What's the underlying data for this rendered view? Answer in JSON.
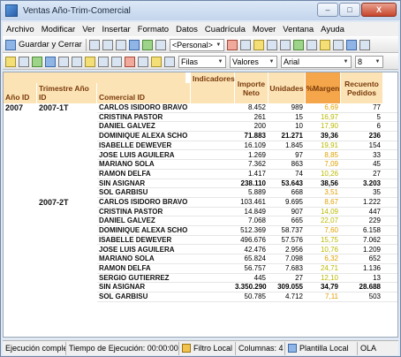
{
  "window": {
    "title": "Ventas Año-Trim-Comercial",
    "controls": [
      "–",
      "□",
      "X"
    ]
  },
  "menu": [
    "Archivo",
    "Modificar",
    "Ver",
    "Insertar",
    "Formato",
    "Datos",
    "Cuadrícula",
    "Mover",
    "Ventana",
    "Ayuda"
  ],
  "toolbar1": {
    "save_close_label": "Guardar y Cerrar",
    "style_select": "<Personal>"
  },
  "toolbar2": {
    "rows_select": "Filas",
    "values_select": "Valores",
    "font_select": "Arial",
    "size_select": "8"
  },
  "grid": {
    "headers": {
      "year": "Año ID",
      "quarter": "Trimestre Año ID",
      "comercial": "Comercial ID",
      "indicadores": "Indicadores",
      "importe": "Importe Neto",
      "unidades": "Unidades",
      "margen": "%Margen",
      "recuento": "Recuento Pedidos"
    },
    "colors": {
      "header_bg": "#fbe3b6",
      "margen_header_bg": "#f5a64a",
      "margen_good": "#b9b900",
      "margen_bad": "#e0a000"
    },
    "year": "2007",
    "groups": [
      {
        "quarter": "2007-1T",
        "rows": [
          {
            "name": "CARLOS ISIDORO BRAVO",
            "importe": "8.452",
            "unidades": "989",
            "margen": "6,69",
            "recuento": "77",
            "bold": false
          },
          {
            "name": "CRISTINA PASTOR",
            "importe": "261",
            "unidades": "15",
            "margen": "16,97",
            "recuento": "5",
            "bold": false
          },
          {
            "name": "DANIEL GALVEZ",
            "importe": "200",
            "unidades": "10",
            "margen": "17,90",
            "recuento": "6",
            "bold": false
          },
          {
            "name": "DOMINIQUE ALEXA SCHO",
            "importe": "71.883",
            "unidades": "21.271",
            "margen": "39,36",
            "recuento": "236",
            "bold": true
          },
          {
            "name": "ISABELLE DEWEVER",
            "importe": "16.109",
            "unidades": "1.845",
            "margen": "19,91",
            "recuento": "154",
            "bold": false
          },
          {
            "name": "JOSE LUIS AGUILERA",
            "importe": "1.269",
            "unidades": "97",
            "margen": "8,85",
            "recuento": "33",
            "bold": false
          },
          {
            "name": "MARIANO SOLA",
            "importe": "7.362",
            "unidades": "863",
            "margen": "7,09",
            "recuento": "45",
            "bold": false
          },
          {
            "name": "RAMON DELFA",
            "importe": "1.417",
            "unidades": "74",
            "margen": "10,26",
            "recuento": "27",
            "bold": false
          },
          {
            "name": "SIN ASIGNAR",
            "importe": "238.110",
            "unidades": "53.643",
            "margen": "38,56",
            "recuento": "3.203",
            "bold": true
          },
          {
            "name": "SOL GARBISU",
            "importe": "5.889",
            "unidades": "668",
            "margen": "3,51",
            "recuento": "35",
            "bold": false
          }
        ]
      },
      {
        "quarter": "2007-2T",
        "rows": [
          {
            "name": "CARLOS ISIDORO BRAVO",
            "importe": "103.461",
            "unidades": "9.695",
            "margen": "8,67",
            "recuento": "1.222",
            "bold": false
          },
          {
            "name": "CRISTINA PASTOR",
            "importe": "14.849",
            "unidades": "907",
            "margen": "14,09",
            "recuento": "447",
            "bold": false
          },
          {
            "name": "DANIEL GALVEZ",
            "importe": "7.068",
            "unidades": "665",
            "margen": "22,07",
            "recuento": "229",
            "bold": false
          },
          {
            "name": "DOMINIQUE ALEXA SCHO",
            "importe": "512.369",
            "unidades": "58.737",
            "margen": "7,60",
            "recuento": "6.158",
            "bold": false
          },
          {
            "name": "ISABELLE DEWEVER",
            "importe": "496.676",
            "unidades": "57.576",
            "margen": "15,75",
            "recuento": "7.062",
            "bold": false
          },
          {
            "name": "JOSE LUIS AGUILERA",
            "importe": "42.476",
            "unidades": "2.956",
            "margen": "10,76",
            "recuento": "1.209",
            "bold": false
          },
          {
            "name": "MARIANO SOLA",
            "importe": "65.824",
            "unidades": "7.098",
            "margen": "6,32",
            "recuento": "652",
            "bold": false
          },
          {
            "name": "RAMON DELFA",
            "importe": "56.757",
            "unidades": "7.683",
            "margen": "24,71",
            "recuento": "1.136",
            "bold": false
          },
          {
            "name": "SERGIO GUTIERREZ",
            "importe": "445",
            "unidades": "27",
            "margen": "12,10",
            "recuento": "13",
            "bold": false
          },
          {
            "name": "SIN ASIGNAR",
            "importe": "3.350.290",
            "unidades": "309.055",
            "margen": "34,79",
            "recuento": "28.688",
            "bold": true
          },
          {
            "name": "SOL GARBISU",
            "importe": "50.785",
            "unidades": "4.712",
            "margen": "7,11",
            "recuento": "503",
            "bold": false
          }
        ]
      }
    ]
  },
  "status": {
    "execution": "Ejecución completa",
    "time": "Tiempo de Ejecución: 00:00:00",
    "filter": "Filtro Local",
    "columns": "Columnas: 4",
    "template": "Plantilla Local",
    "ola": "OLA"
  }
}
